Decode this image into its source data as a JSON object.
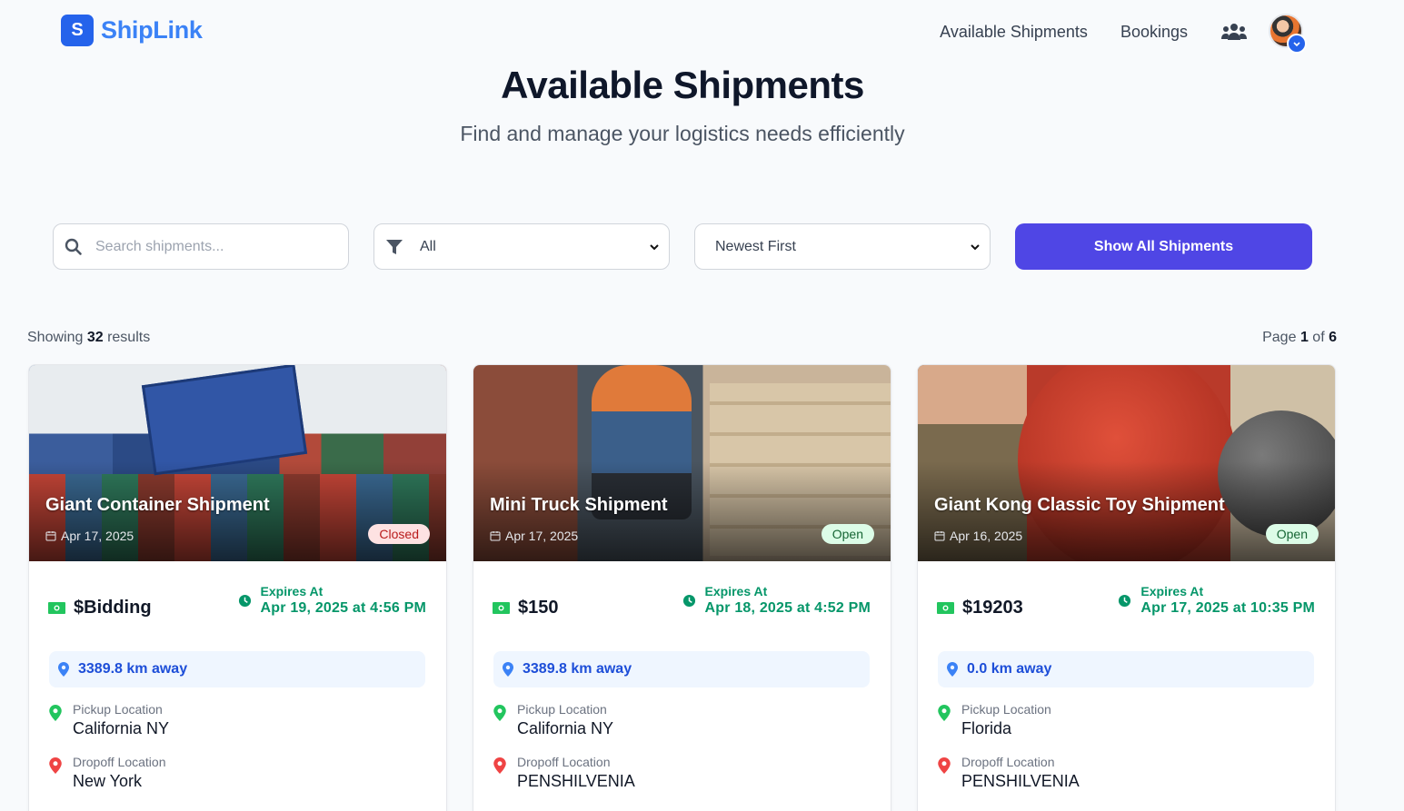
{
  "app": {
    "name": "ShipLink",
    "logo_letter": "S",
    "brand_color": "#2563eb"
  },
  "nav": {
    "items": [
      "Available Shipments",
      "Bookings"
    ]
  },
  "hero": {
    "title": "Available Shipments",
    "subtitle": "Find and manage your logistics needs efficiently"
  },
  "controls": {
    "search_placeholder": "Search shipments...",
    "filter_value": "All",
    "sort_value": "Newest First",
    "show_all_label": "Show All Shipments"
  },
  "results": {
    "prefix": "Showing",
    "count": "32",
    "suffix": "results",
    "page_prefix": "Page",
    "page": "1",
    "page_of": "of",
    "total_pages": "6"
  },
  "cards": [
    {
      "title": "Giant Container Shipment",
      "date": "Apr 17, 2025",
      "status": "Closed",
      "price": "$Bidding",
      "expires_label": "Expires At",
      "expires": "Apr 19, 2025 at 4:56 PM",
      "distance": "3389.8 km away",
      "pickup_label": "Pickup Location",
      "pickup": "California NY",
      "dropoff_label": "Dropoff Location",
      "dropoff": "New York"
    },
    {
      "title": "Mini Truck Shipment",
      "date": "Apr 17, 2025",
      "status": "Open",
      "price": "$150",
      "expires_label": "Expires At",
      "expires": "Apr 18, 2025 at 4:52 PM",
      "distance": "3389.8 km away",
      "pickup_label": "Pickup Location",
      "pickup": "California NY",
      "dropoff_label": "Dropoff Location",
      "dropoff": "PENSHILVENIA"
    },
    {
      "title": "Giant Kong Classic Toy Shipment",
      "date": "Apr 16, 2025",
      "status": "Open",
      "price": "$19203",
      "expires_label": "Expires At",
      "expires": "Apr 17, 2025 at 10:35 PM",
      "distance": "0.0 km away",
      "pickup_label": "Pickup Location",
      "pickup": "Florida",
      "dropoff_label": "Dropoff Location",
      "dropoff": "PENSHILVENIA"
    }
  ],
  "colors": {
    "accent": "#4f46e5",
    "success": "#059669",
    "closed": "#b91c1c",
    "distance": "#1d4ed8"
  },
  "icons": [
    "users-icon",
    "user-icon",
    "search-icon",
    "filter-icon",
    "calendar-icon",
    "money-icon",
    "clock-icon",
    "map-pin-icon"
  ]
}
